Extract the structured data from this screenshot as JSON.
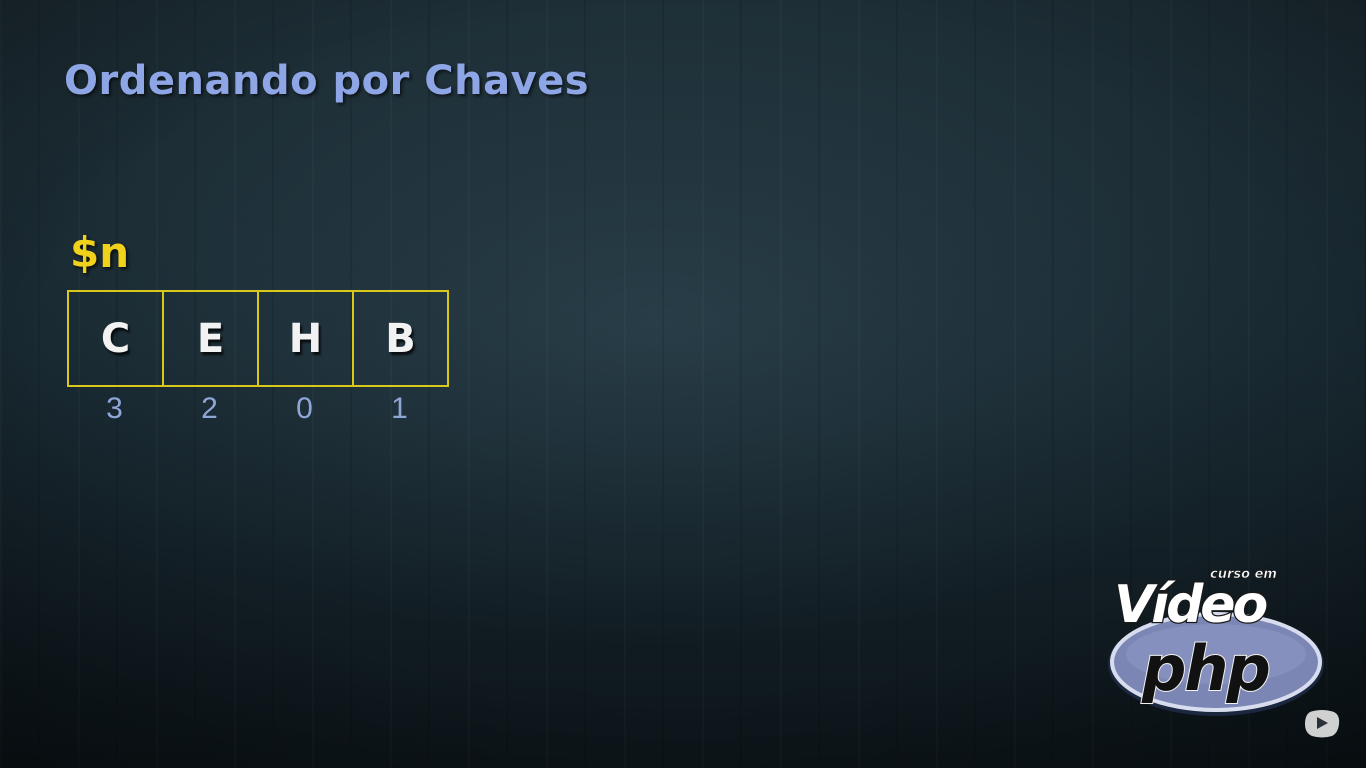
{
  "slide": {
    "title": "Ordenando por Chaves",
    "variable": "$n",
    "array": [
      {
        "value": "C",
        "key": "3"
      },
      {
        "value": "E",
        "key": "2"
      },
      {
        "value": "H",
        "key": "0"
      },
      {
        "value": "B",
        "key": "1"
      }
    ]
  },
  "logo": {
    "small_text": "curso em",
    "main_text": "Vídeo",
    "sub_text": "php"
  },
  "icons": {
    "watermark": "youtube-play-icon"
  },
  "colors": {
    "title": "#8fa6e6",
    "variable": "#f0d21a",
    "cell_border": "#d9c81c",
    "key_text": "#8fa6d8"
  }
}
